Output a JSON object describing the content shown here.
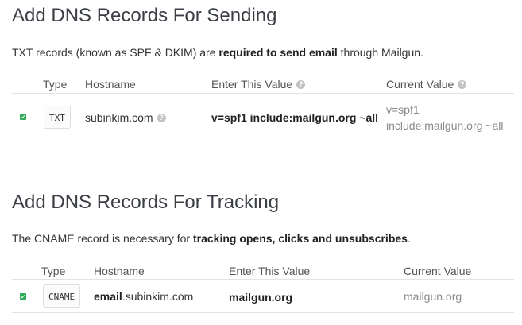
{
  "sending": {
    "title": "Add DNS Records For Sending",
    "desc_pre": "TXT records (known as SPF & DKIM) are ",
    "desc_bold": "required to send email",
    "desc_post": " through Mailgun.",
    "headers": {
      "type": "Type",
      "hostname": "Hostname",
      "enter_value": "Enter This Value",
      "current_value": "Current Value"
    },
    "row": {
      "type": "TXT",
      "hostname": "subinkim.com",
      "value": "v=spf1 include:mailgun.org ~all",
      "current_line1": "v=spf1",
      "current_line2": "include:mailgun.org ~all"
    }
  },
  "tracking": {
    "title": "Add DNS Records For Tracking",
    "desc_pre": "The CNAME record is necessary for ",
    "desc_bold": "tracking opens, clicks and unsubscribes",
    "desc_post": ".",
    "headers": {
      "type": "Type",
      "hostname": "Hostname",
      "enter_value": "Enter This Value",
      "current_value": "Current Value"
    },
    "row": {
      "type": "CNAME",
      "hostname_bold": "email",
      "hostname_rest": ".subinkim.com",
      "value": "mailgun.org",
      "current": "mailgun.org"
    }
  },
  "icons": {
    "help": "question-circle-icon",
    "status": "check-square-icon"
  },
  "colors": {
    "status_ok": "#2faa5a",
    "rule": "#e3e3e3"
  }
}
